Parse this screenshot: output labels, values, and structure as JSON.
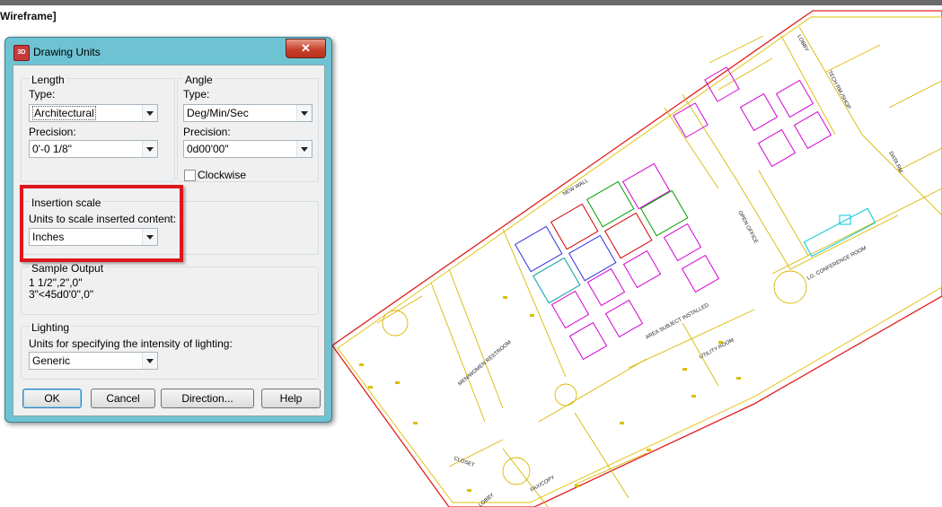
{
  "view_label": "Wireframe]",
  "dialog": {
    "title": "Drawing Units",
    "app_icon_text": "3D",
    "close_glyph": "✕",
    "length": {
      "group_label": "Length",
      "type_label": "Type:",
      "type_value": "Architectural",
      "precision_label": "Precision:",
      "precision_value": "0'-0 1/8\""
    },
    "angle": {
      "group_label": "Angle",
      "type_label": "Type:",
      "type_value": "Deg/Min/Sec",
      "precision_label": "Precision:",
      "precision_value": "0d00'00\"",
      "clockwise_label": "Clockwise",
      "clockwise_checked": false
    },
    "insertion": {
      "group_label": "Insertion scale",
      "units_label": "Units to scale inserted content:",
      "units_value": "Inches"
    },
    "sample": {
      "group_label": "Sample Output",
      "line1": "1 1/2\",2\",0\"",
      "line2": "3\"<45d0'0\",0\""
    },
    "lighting": {
      "group_label": "Lighting",
      "units_label": "Units for specifying the intensity of lighting:",
      "units_value": "Generic"
    },
    "buttons": {
      "ok": "OK",
      "cancel": "Cancel",
      "direction": "Direction...",
      "help": "Help"
    }
  },
  "floorplan": {
    "labels": {
      "lobby_top": "LOBBY",
      "tech_shop": "TECH RM./SHOP",
      "data": "DATA RM.",
      "conference": "LG. CONFERENCE ROOM",
      "utility": "UTILITY ROOM",
      "restroom": "MEN/WOMEN RESTROOM",
      "fax": "FAX/COPY",
      "lobby_bottom": "LOBBY",
      "closet": "CLOSET",
      "new_wall": "NEW WALL",
      "open_office": "OPEN OFFICE",
      "area": "AREA SUBJECT INSTALLED"
    }
  }
}
